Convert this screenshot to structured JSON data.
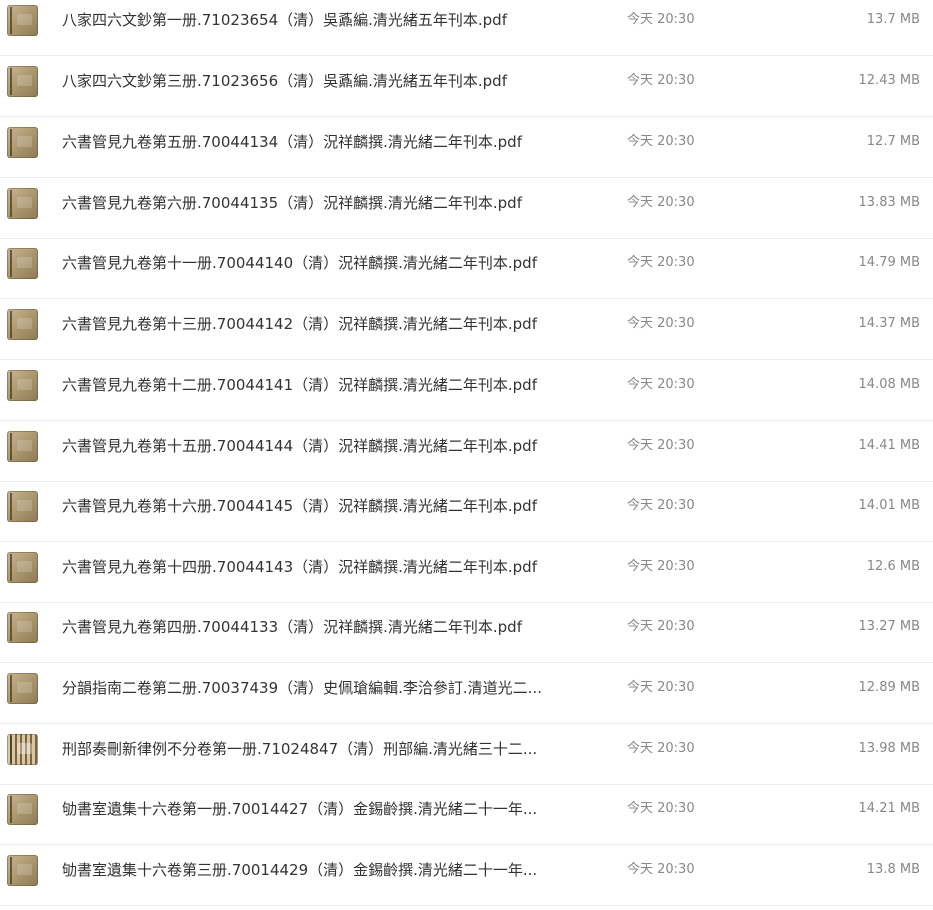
{
  "files": [
    {
      "name": "八家四六文鈔第一册.71023654（清）吳鼒編.清光緒五年刊本.pdf",
      "time": "今天 20:30",
      "size": "13.7 MB",
      "thumb_icon": "pdf-thumbnail-icon"
    },
    {
      "name": "八家四六文鈔第三册.71023656（清）吳鼒編.清光緒五年刊本.pdf",
      "time": "今天 20:30",
      "size": "12.43 MB",
      "thumb_icon": "pdf-thumbnail-icon"
    },
    {
      "name": "六書管見九卷第五册.70044134（清）況祥麟撰.清光緒二年刊本.pdf",
      "time": "今天 20:30",
      "size": "12.7 MB",
      "thumb_icon": "pdf-thumbnail-icon"
    },
    {
      "name": "六書管見九卷第六册.70044135（清）況祥麟撰.清光緒二年刊本.pdf",
      "time": "今天 20:30",
      "size": "13.83 MB",
      "thumb_icon": "pdf-thumbnail-icon"
    },
    {
      "name": "六書管見九卷第十一册.70044140（清）況祥麟撰.清光緒二年刊本.pdf",
      "time": "今天 20:30",
      "size": "14.79 MB",
      "thumb_icon": "pdf-thumbnail-icon"
    },
    {
      "name": "六書管見九卷第十三册.70044142（清）況祥麟撰.清光緒二年刊本.pdf",
      "time": "今天 20:30",
      "size": "14.37 MB",
      "thumb_icon": "pdf-thumbnail-icon"
    },
    {
      "name": "六書管見九卷第十二册.70044141（清）況祥麟撰.清光緒二年刊本.pdf",
      "time": "今天 20:30",
      "size": "14.08 MB",
      "thumb_icon": "pdf-thumbnail-icon"
    },
    {
      "name": "六書管見九卷第十五册.70044144（清）況祥麟撰.清光緒二年刊本.pdf",
      "time": "今天 20:30",
      "size": "14.41 MB",
      "thumb_icon": "pdf-thumbnail-icon"
    },
    {
      "name": "六書管見九卷第十六册.70044145（清）況祥麟撰.清光緒二年刊本.pdf",
      "time": "今天 20:30",
      "size": "14.01 MB",
      "thumb_icon": "pdf-thumbnail-icon"
    },
    {
      "name": "六書管見九卷第十四册.70044143（清）況祥麟撰.清光緒二年刊本.pdf",
      "time": "今天 20:30",
      "size": "12.6 MB",
      "thumb_icon": "pdf-thumbnail-icon"
    },
    {
      "name": "六書管見九卷第四册.70044133（清）況祥麟撰.清光緒二年刊本.pdf",
      "time": "今天 20:30",
      "size": "13.27 MB",
      "thumb_icon": "pdf-thumbnail-icon"
    },
    {
      "name": "分韻指南二卷第二册.70037439（清）史佩瑲編輯.李洽參訂.清道光二...",
      "time": "今天 20:30",
      "size": "12.89 MB",
      "thumb_icon": "pdf-thumbnail-icon"
    },
    {
      "name": "刑部奏刪新律例不分卷第一册.71024847（清）刑部編.清光緒三十二...",
      "time": "今天 20:30",
      "size": "13.98 MB",
      "thumb_icon": "pdf-thumbnail-ornate-icon"
    },
    {
      "name": "劬書室遺集十六卷第一册.70014427（清）金錫齡撰.清光緒二十一年...",
      "time": "今天 20:30",
      "size": "14.21 MB",
      "thumb_icon": "pdf-thumbnail-icon"
    },
    {
      "name": "劬書室遺集十六卷第三册.70014429（清）金錫齡撰.清光緒二十一年...",
      "time": "今天 20:30",
      "size": "13.8 MB",
      "thumb_icon": "pdf-thumbnail-icon"
    }
  ]
}
